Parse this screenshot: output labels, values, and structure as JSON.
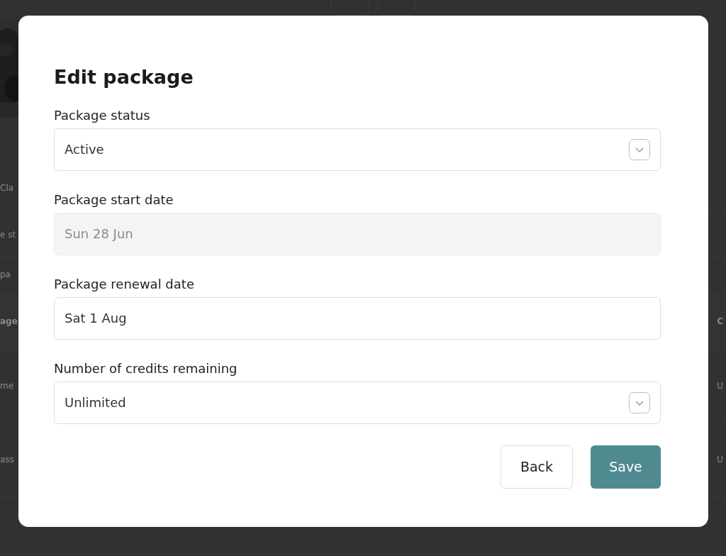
{
  "background": {
    "rows": [
      {
        "left": "Cla",
        "header": false
      },
      {
        "left": "e st",
        "header": false
      },
      {
        "left": "pa",
        "header": false
      },
      {
        "left": "age",
        "right": "C",
        "header": true
      },
      {
        "left": "me",
        "right": "U",
        "header": false
      },
      {
        "left": "ass",
        "right": "U",
        "header": false
      }
    ]
  },
  "dialog": {
    "title": "Edit package",
    "fields": [
      {
        "label": "Package status",
        "kind": "select",
        "value": "Active",
        "disabled": false
      },
      {
        "label": "Package start date",
        "kind": "text",
        "value": "Sun 28 Jun",
        "disabled": true
      },
      {
        "label": "Package renewal date",
        "kind": "text",
        "value": "Sat 1 Aug",
        "disabled": false
      },
      {
        "label": "Number of credits remaining",
        "kind": "select",
        "value": "Unlimited",
        "disabled": false
      }
    ],
    "buttons": [
      {
        "label": "Back",
        "kind": "secondary"
      },
      {
        "label": "Save",
        "kind": "primary"
      }
    ]
  }
}
